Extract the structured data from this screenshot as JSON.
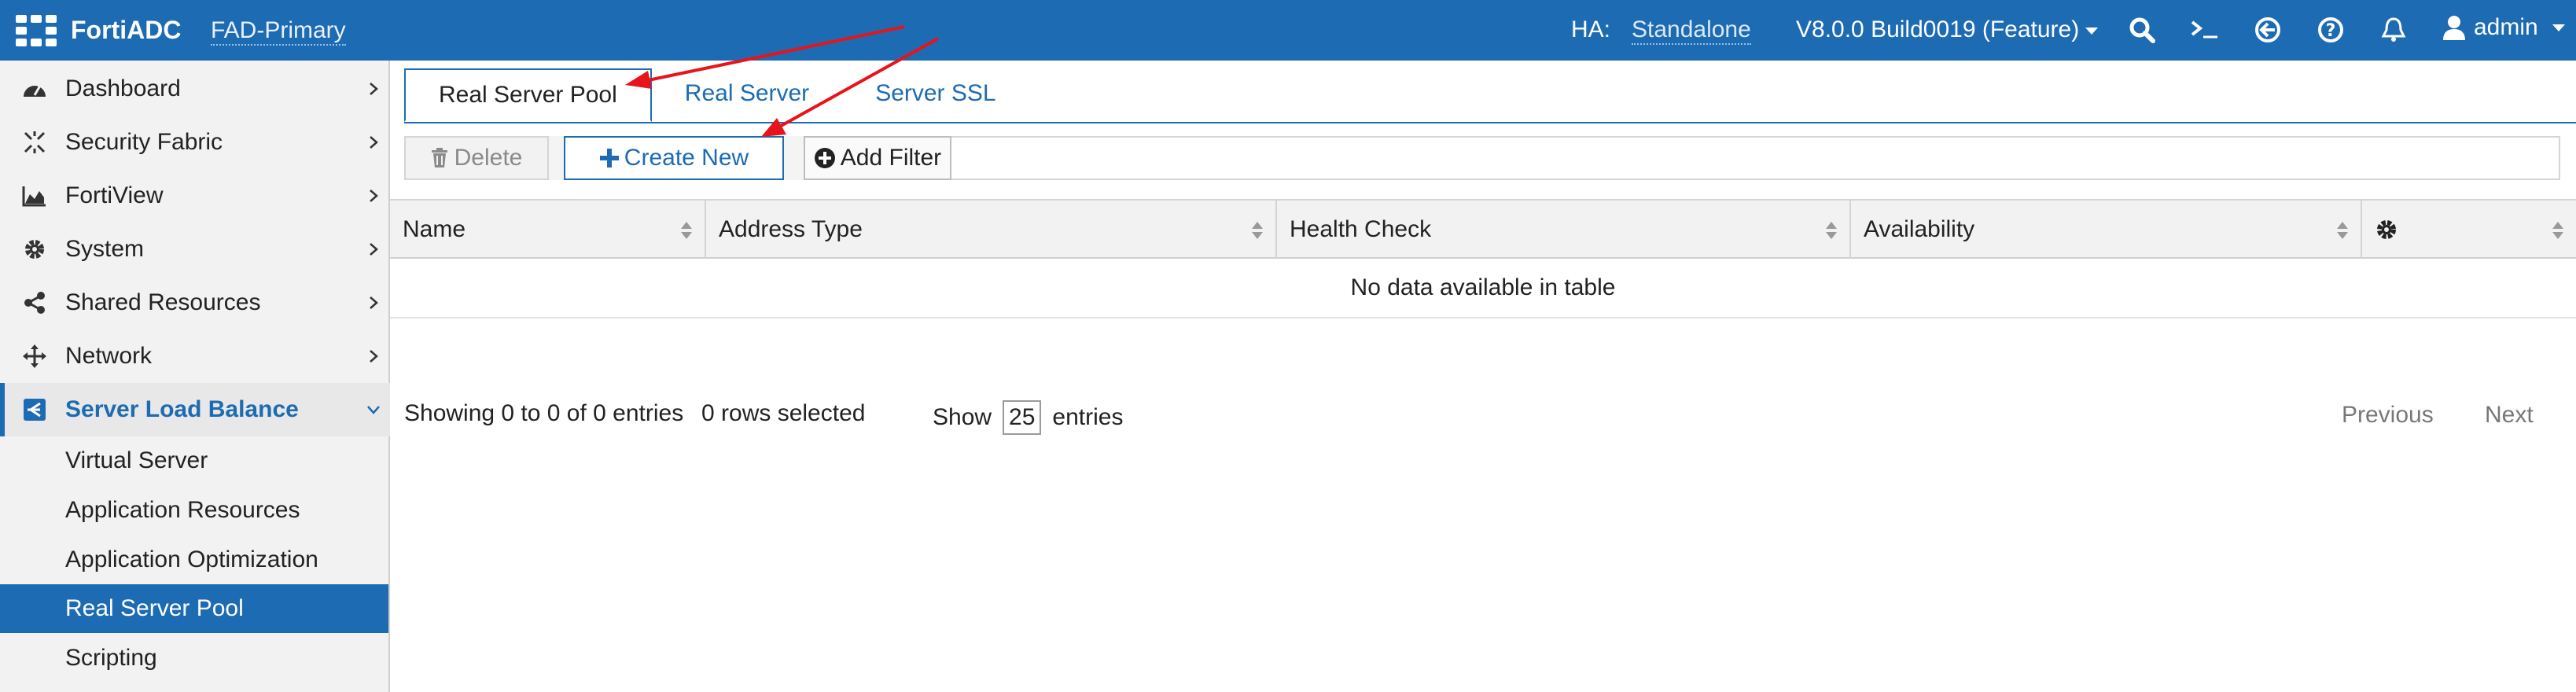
{
  "app": {
    "brand": "FortiADC",
    "hostname": "FAD-Primary"
  },
  "header": {
    "ha_label": "HA:",
    "ha_value": "Standalone",
    "version": "V8.0.0 Build0019 (Feature)",
    "user": "admin",
    "icons": [
      "search-icon",
      "cli-console-icon",
      "logout-icon",
      "help-icon",
      "notifications-bell-icon",
      "user-icon"
    ]
  },
  "sidebar": {
    "items": [
      {
        "label": "Dashboard",
        "icon": "dashboard-gauge-icon"
      },
      {
        "label": "Security Fabric",
        "icon": "security-fabric-icon"
      },
      {
        "label": "FortiView",
        "icon": "area-chart-icon"
      },
      {
        "label": "System",
        "icon": "gear-icon"
      },
      {
        "label": "Shared Resources",
        "icon": "share-nodes-icon"
      },
      {
        "label": "Network",
        "icon": "arrows-move-icon"
      },
      {
        "label": "Server Load Balance",
        "icon": "load-balance-icon"
      }
    ],
    "subitems": [
      {
        "label": "Virtual Server"
      },
      {
        "label": "Application Resources"
      },
      {
        "label": "Application Optimization"
      },
      {
        "label": "Real Server Pool"
      },
      {
        "label": "Scripting"
      }
    ]
  },
  "tabs": [
    {
      "label": "Real Server Pool",
      "active": true
    },
    {
      "label": "Real Server"
    },
    {
      "label": "Server SSL"
    }
  ],
  "toolbar": {
    "delete_label": "Delete",
    "create_label": "Create New",
    "filter_label": "Add Filter"
  },
  "table": {
    "columns": [
      "Name",
      "Address Type",
      "Health Check",
      "Availability"
    ],
    "settings_icon": "gear-icon",
    "empty_message": "No data available in table"
  },
  "footer": {
    "info": "Showing 0 to 0 of 0 entries",
    "selected": "0 rows selected",
    "show_label": "Show",
    "page_size": "25",
    "entries_label": "entries",
    "previous": "Previous",
    "next": "Next"
  },
  "colors": {
    "brand_blue": "#1c6bb3",
    "annotation_red": "#e8141b"
  }
}
